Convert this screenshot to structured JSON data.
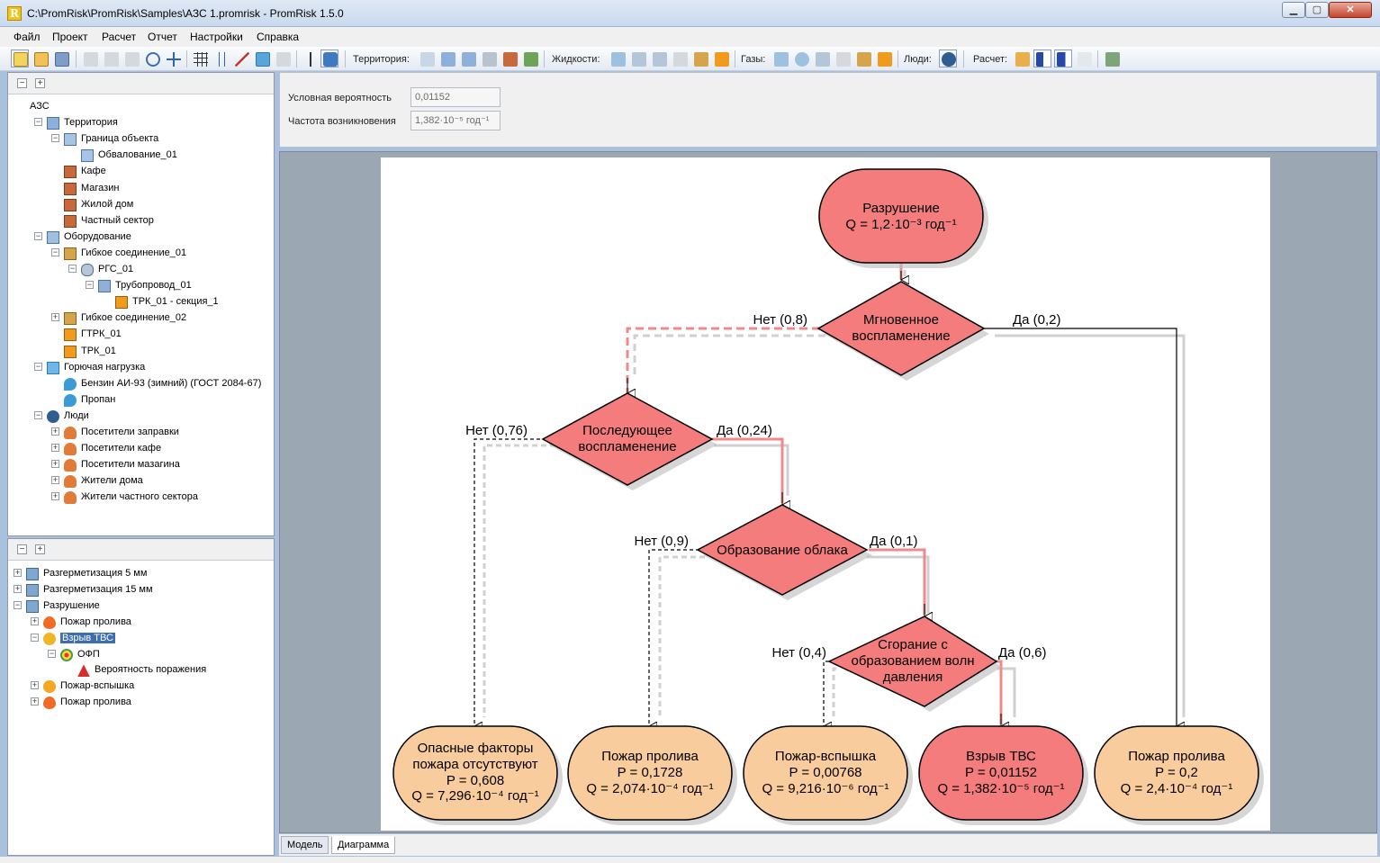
{
  "window": {
    "title": "C:\\PromRisk\\PromRisk\\Samples\\АЗС 1.promrisk - PromRisk 1.5.0",
    "app_icon_letter": "R",
    "min": "▁",
    "max": "▢",
    "close": "✕"
  },
  "menu": [
    "Файл",
    "Проект",
    "Расчет",
    "Отчет",
    "Настройки",
    "Справка"
  ],
  "toolbar": {
    "territory_label": "Территория:",
    "liquids_label": "Жидкости:",
    "gases_label": "Газы:",
    "people_label": "Люди:",
    "calc_label": "Расчет:"
  },
  "tree_top": [
    {
      "label": "АЗС",
      "level": 0,
      "exp": "",
      "icon": "none"
    },
    {
      "label": "Территория",
      "level": 1,
      "exp": "−",
      "icon": "territory-icon"
    },
    {
      "label": "Граница объекта",
      "level": 2,
      "exp": "−",
      "icon": "boundary-icon"
    },
    {
      "label": "Обвалование_01",
      "level": 3,
      "exp": "",
      "icon": "embankment-icon"
    },
    {
      "label": "Кафе",
      "level": 2,
      "exp": "",
      "icon": "building-icon"
    },
    {
      "label": "Магазин",
      "level": 2,
      "exp": "",
      "icon": "building-icon"
    },
    {
      "label": "Жилой дом",
      "level": 2,
      "exp": "",
      "icon": "building-icon"
    },
    {
      "label": "Частный сектор",
      "level": 2,
      "exp": "",
      "icon": "building-icon"
    },
    {
      "label": "Оборудование",
      "level": 1,
      "exp": "−",
      "icon": "equipment-icon"
    },
    {
      "label": "Гибкое соединение_01",
      "level": 2,
      "exp": "−",
      "icon": "hose-icon"
    },
    {
      "label": "РГС_01",
      "level": 3,
      "exp": "−",
      "icon": "tank-icon"
    },
    {
      "label": "Трубопровод_01",
      "level": 4,
      "exp": "−",
      "icon": "pipeline-icon"
    },
    {
      "label": "ТРК_01 - секция_1",
      "level": 5,
      "exp": "",
      "icon": "dispenser-icon"
    },
    {
      "label": "Гибкое соединение_02",
      "level": 2,
      "exp": "+",
      "icon": "hose-icon"
    },
    {
      "label": "ГТРК_01",
      "level": 2,
      "exp": "",
      "icon": "dispenser-icon"
    },
    {
      "label": "ТРК_01",
      "level": 2,
      "exp": "",
      "icon": "dispenser-icon"
    },
    {
      "label": "Горючая нагрузка",
      "level": 1,
      "exp": "−",
      "icon": "fuel-icon"
    },
    {
      "label": "Бензин АИ-93 (зимний) (ГОСТ 2084-67)",
      "level": 2,
      "exp": "",
      "icon": "drop-icon"
    },
    {
      "label": "Пропан",
      "level": 2,
      "exp": "",
      "icon": "drop-icon"
    },
    {
      "label": "Люди",
      "level": 1,
      "exp": "−",
      "icon": "people-icon"
    },
    {
      "label": "Посетители заправки",
      "level": 2,
      "exp": "+",
      "icon": "persons-icon"
    },
    {
      "label": "Посетители кафе",
      "level": 2,
      "exp": "+",
      "icon": "persons-icon"
    },
    {
      "label": "Посетители мазагина",
      "level": 2,
      "exp": "+",
      "icon": "persons-icon"
    },
    {
      "label": "Жители дома",
      "level": 2,
      "exp": "+",
      "icon": "persons-icon"
    },
    {
      "label": "Жители частного сектора",
      "level": 2,
      "exp": "+",
      "icon": "persons-icon"
    }
  ],
  "tree_bottom": [
    {
      "label": "Разгерметизация 5 мм",
      "level": 0,
      "exp": "+",
      "icon": "leak-icon"
    },
    {
      "label": "Разгерметизация 15 мм",
      "level": 0,
      "exp": "+",
      "icon": "leak-icon"
    },
    {
      "label": "Разрушение",
      "level": 0,
      "exp": "−",
      "icon": "leak-icon"
    },
    {
      "label": "Пожар пролива",
      "level": 1,
      "exp": "+",
      "icon": "fire-icon"
    },
    {
      "label": "Взрыв ТВС",
      "level": 1,
      "exp": "−",
      "icon": "explosion-icon",
      "selected": true
    },
    {
      "label": "ОФП",
      "level": 2,
      "exp": "−",
      "icon": "target-icon"
    },
    {
      "label": "Вероятность поражения",
      "level": 3,
      "exp": "",
      "icon": "warning-icon"
    },
    {
      "label": "Пожар-вспышка",
      "level": 1,
      "exp": "+",
      "icon": "flash-icon"
    },
    {
      "label": "Пожар пролива",
      "level": 1,
      "exp": "+",
      "icon": "fire-icon"
    }
  ],
  "properties": {
    "prob_label": "Условная вероятность",
    "prob_value": "0,01152",
    "freq_label": "Частота возникновения",
    "freq_value": "1,382·10⁻⁵ год⁻¹"
  },
  "diagram": {
    "start": {
      "l1": "Разрушение",
      "l2": "Q = 1,2·10⁻³ год⁻¹"
    },
    "d1": {
      "l1": "Мгновенное",
      "l2": "воспламенение",
      "no": "Нет (0,8)",
      "yes": "Да (0,2)"
    },
    "d2": {
      "l1": "Последующее",
      "l2": "воспламенение",
      "no": "Нет (0,76)",
      "yes": "Да (0,24)"
    },
    "d3": {
      "l1": "Образование облака",
      "no": "Нет (0,9)",
      "yes": "Да (0,1)"
    },
    "d4": {
      "l1": "Сгорание с",
      "l2": "образованием волн",
      "l3": "давления",
      "no": "Нет (0,4)",
      "yes": "Да (0,6)"
    },
    "outcomes": [
      {
        "l1": "Опасные факторы",
        "l2": "пожара отсутствуют",
        "p": "P = 0,608",
        "q": "Q = 7,296·10⁻⁴ год⁻¹"
      },
      {
        "l1": "Пожар пролива",
        "p": "P = 0,1728",
        "q": "Q = 2,074·10⁻⁴ год⁻¹"
      },
      {
        "l1": "Пожар-вспышка",
        "p": "P = 0,00768",
        "q": "Q = 9,216·10⁻⁶ год⁻¹"
      },
      {
        "l1": "Взрыв ТВС",
        "p": "P = 0,01152",
        "q": "Q = 1,382·10⁻⁵ год⁻¹"
      },
      {
        "l1": "Пожар пролива",
        "p": "P = 0,2",
        "q": "Q = 2,4·10⁻⁴ год⁻¹"
      }
    ],
    "colors": {
      "red": "#f47c7c",
      "orange": "#f9cc9d",
      "line_red": "#f08a8a"
    }
  },
  "tabs": [
    "Модель",
    "Диаграмма"
  ]
}
